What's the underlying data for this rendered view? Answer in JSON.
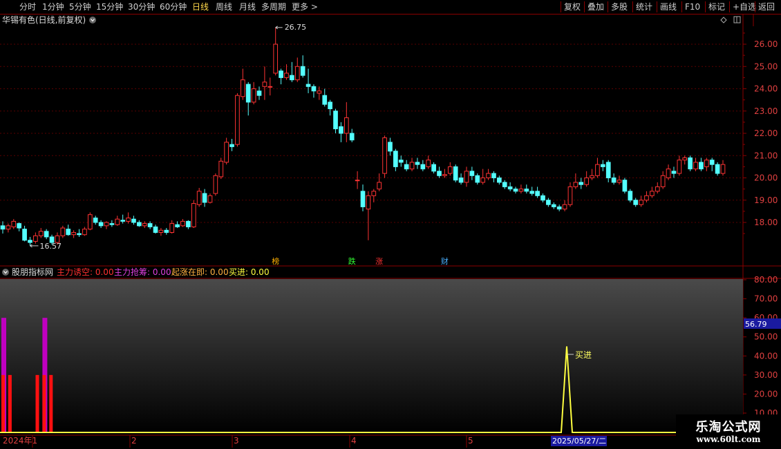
{
  "toolbar": {
    "left": [
      {
        "name": "tab-fenshi",
        "label": "分时"
      },
      {
        "name": "tab-1min",
        "label": "1分钟"
      },
      {
        "name": "tab-5min",
        "label": "5分钟"
      },
      {
        "name": "tab-15min",
        "label": "15分钟"
      },
      {
        "name": "tab-30min",
        "label": "30分钟"
      },
      {
        "name": "tab-60min",
        "label": "60分钟"
      },
      {
        "name": "tab-daily",
        "label": "日线",
        "active": true
      },
      {
        "name": "tab-weekly",
        "label": "周线"
      },
      {
        "name": "tab-monthly",
        "label": "月线"
      },
      {
        "name": "tab-multi-period",
        "label": "多周期"
      },
      {
        "name": "tab-more",
        "label": "更多 >"
      }
    ],
    "right": [
      {
        "name": "btn-fuquan",
        "label": "复权"
      },
      {
        "name": "btn-diejia",
        "label": "叠加"
      },
      {
        "name": "btn-duogu",
        "label": "多股"
      },
      {
        "name": "btn-tongji",
        "label": "统计"
      },
      {
        "name": "btn-huaxian",
        "label": "画线"
      },
      {
        "name": "btn-f10",
        "label": "F10"
      },
      {
        "name": "btn-biaoji",
        "label": "标记"
      },
      {
        "name": "btn-zixuan",
        "label": "+自选"
      },
      {
        "name": "btn-fanhui",
        "label": "返回"
      }
    ]
  },
  "main_panel": {
    "title": "华锡有色(日线,前复权)",
    "y_ticks": [
      "26.00",
      "25.00",
      "24.00",
      "23.00",
      "22.00",
      "21.00",
      "20.00",
      "19.00",
      "18.00"
    ],
    "high_label": "26.75",
    "low_label": "16.57",
    "markers": [
      {
        "label": "榜",
        "color": "#ffb000",
        "idx": 50
      },
      {
        "label": "跌",
        "color": "#33ff33",
        "idx": 64
      },
      {
        "label": "涨",
        "color": "#ff3333",
        "idx": 69
      },
      {
        "label": "财",
        "color": "#4ab0ff",
        "idx": 81
      }
    ]
  },
  "indicator_panel": {
    "title": "股朋指标网",
    "legend": [
      {
        "label": "主力诱空: 0.00",
        "color": "#ff3030"
      },
      {
        "label": "主力抢筹: 0.00",
        "color": "#e040e0"
      },
      {
        "label": "起涨在即: 0.00",
        "color": "#ffb040"
      },
      {
        "label": "买进: 0.00",
        "color": "#ffff40"
      }
    ],
    "y_ticks": [
      "80.00",
      "70.00",
      "60.00",
      "50.00",
      "40.00",
      "30.00",
      "20.00",
      "10.00"
    ],
    "current_value": "56.79",
    "buy_label": "买进"
  },
  "timeline": {
    "year_label": "2024年1",
    "months": [
      "2",
      "3",
      "4",
      "5"
    ],
    "cursor_date": "2025/05/27/二"
  },
  "watermark": {
    "title": "乐淘公式网",
    "url": "www.60lt.com"
  },
  "colors": {
    "up": "#ff3333",
    "down": "#54ffff",
    "axis": "#8b0000",
    "buy_line": "#ffff40"
  },
  "chart_data": {
    "type": "candlestick",
    "ylim": [
      17.0,
      27.0
    ],
    "candles": [
      [
        17.85,
        17.7,
        18.05,
        17.5
      ],
      [
        17.7,
        17.85,
        17.95,
        17.55
      ],
      [
        17.8,
        18.05,
        18.15,
        17.7
      ],
      [
        17.95,
        17.75,
        18.0,
        17.6
      ],
      [
        17.7,
        17.2,
        17.85,
        17.15
      ],
      [
        17.2,
        17.1,
        17.35,
        16.95
      ],
      [
        17.15,
        17.4,
        17.55,
        17.05
      ],
      [
        17.4,
        17.6,
        17.75,
        17.3
      ],
      [
        17.6,
        17.35,
        17.7,
        17.25
      ],
      [
        17.35,
        17.1,
        17.45,
        17.0
      ],
      [
        17.1,
        17.4,
        17.55,
        17.0
      ],
      [
        17.4,
        17.75,
        17.85,
        17.3
      ],
      [
        17.7,
        17.45,
        17.9,
        17.4
      ],
      [
        17.45,
        17.55,
        17.65,
        17.3
      ],
      [
        17.5,
        17.45,
        17.7,
        17.35
      ],
      [
        17.45,
        17.7,
        17.8,
        17.4
      ],
      [
        17.7,
        18.35,
        18.45,
        17.65
      ],
      [
        18.2,
        18.0,
        18.3,
        17.9
      ],
      [
        18.0,
        17.85,
        18.1,
        17.75
      ],
      [
        17.85,
        18.0,
        18.05,
        17.7
      ],
      [
        17.95,
        17.9,
        18.1,
        17.8
      ],
      [
        17.9,
        18.15,
        18.3,
        17.85
      ],
      [
        18.1,
        18.05,
        18.35,
        17.95
      ],
      [
        18.05,
        18.2,
        18.45,
        17.95
      ],
      [
        18.15,
        18.0,
        18.3,
        17.9
      ],
      [
        18.0,
        17.85,
        18.1,
        17.8
      ],
      [
        17.85,
        17.95,
        18.05,
        17.75
      ],
      [
        17.95,
        17.8,
        18.05,
        17.7
      ],
      [
        17.8,
        17.55,
        17.9,
        17.5
      ],
      [
        17.55,
        17.65,
        17.75,
        17.4
      ],
      [
        17.65,
        17.55,
        17.75,
        17.45
      ],
      [
        17.55,
        17.95,
        18.1,
        17.5
      ],
      [
        17.9,
        17.8,
        18.05,
        17.75
      ],
      [
        17.85,
        18.05,
        18.15,
        17.8
      ],
      [
        18.05,
        17.8,
        18.1,
        17.7
      ],
      [
        17.8,
        18.85,
        19.0,
        17.75
      ],
      [
        18.8,
        19.4,
        19.55,
        18.7
      ],
      [
        19.3,
        18.9,
        19.5,
        18.7
      ],
      [
        18.9,
        19.2,
        19.3,
        18.85
      ],
      [
        19.3,
        20.1,
        20.2,
        19.2
      ],
      [
        20.05,
        20.75,
        20.9,
        19.95
      ],
      [
        20.7,
        21.6,
        21.8,
        20.6
      ],
      [
        21.5,
        21.4,
        21.75,
        21.2
      ],
      [
        21.5,
        23.7,
        23.8,
        21.4
      ],
      [
        23.65,
        24.4,
        24.9,
        23.5
      ],
      [
        24.2,
        23.4,
        24.3,
        22.8
      ],
      [
        23.4,
        24.0,
        24.3,
        23.3
      ],
      [
        23.9,
        23.7,
        24.1,
        23.5
      ],
      [
        24.1,
        24.3,
        25.0,
        23.5
      ],
      [
        24.1,
        24.1,
        24.5,
        23.7
      ],
      [
        24.7,
        26.0,
        26.75,
        24.6
      ],
      [
        24.8,
        24.5,
        24.9,
        24.2
      ],
      [
        24.5,
        24.7,
        25.1,
        24.4
      ],
      [
        24.6,
        24.4,
        25.2,
        24.3
      ],
      [
        24.4,
        25.0,
        25.4,
        24.3
      ],
      [
        25.0,
        24.6,
        25.5,
        24.5
      ],
      [
        24.2,
        24.1,
        24.9,
        23.8
      ],
      [
        24.1,
        23.9,
        24.2,
        23.6
      ],
      [
        23.8,
        23.9,
        24.1,
        23.5
      ],
      [
        23.7,
        23.3,
        24.0,
        23.2
      ],
      [
        23.4,
        23.1,
        23.5,
        22.8
      ],
      [
        23.0,
        22.2,
        23.1,
        22.0
      ],
      [
        22.3,
        22.0,
        22.5,
        21.6
      ],
      [
        22.0,
        22.7,
        23.4,
        21.6
      ],
      [
        22.0,
        21.7,
        22.2,
        21.6
      ],
      [
        19.9,
        19.9,
        20.3,
        19.5
      ],
      [
        19.4,
        18.7,
        19.7,
        18.5
      ],
      [
        18.6,
        19.2,
        19.4,
        17.2
      ],
      [
        19.2,
        19.4,
        19.5,
        18.9
      ],
      [
        19.5,
        19.8,
        20.2,
        19.4
      ],
      [
        20.2,
        21.8,
        21.9,
        20.0
      ],
      [
        21.6,
        21.2,
        21.8,
        21.0
      ],
      [
        21.2,
        20.5,
        21.3,
        20.3
      ],
      [
        20.8,
        20.7,
        21.0,
        20.5
      ],
      [
        20.6,
        20.4,
        20.8,
        20.3
      ],
      [
        20.4,
        20.7,
        20.9,
        20.3
      ],
      [
        20.7,
        20.6,
        20.9,
        20.4
      ],
      [
        20.6,
        20.4,
        20.8,
        20.3
      ],
      [
        20.5,
        20.8,
        21.0,
        20.4
      ],
      [
        20.6,
        20.3,
        20.7,
        20.2
      ],
      [
        20.3,
        20.1,
        20.5,
        20.0
      ],
      [
        20.1,
        20.15,
        20.4,
        20.0
      ],
      [
        20.2,
        20.5,
        20.7,
        20.1
      ],
      [
        20.5,
        19.9,
        20.6,
        19.8
      ],
      [
        20.0,
        19.8,
        20.2,
        19.7
      ],
      [
        19.8,
        20.3,
        20.5,
        19.6
      ],
      [
        20.3,
        20.1,
        20.5,
        19.9
      ],
      [
        20.1,
        19.8,
        20.2,
        19.7
      ],
      [
        19.8,
        20.0,
        20.4,
        19.7
      ],
      [
        20.0,
        20.2,
        20.4,
        19.9
      ],
      [
        20.2,
        20.0,
        20.3,
        19.8
      ],
      [
        20.0,
        19.8,
        20.1,
        19.7
      ],
      [
        19.8,
        19.6,
        19.9,
        19.5
      ],
      [
        19.6,
        19.5,
        19.8,
        19.4
      ],
      [
        19.5,
        19.4,
        19.6,
        19.3
      ],
      [
        19.4,
        19.5,
        19.7,
        19.3
      ],
      [
        19.5,
        19.4,
        19.7,
        19.3
      ],
      [
        19.4,
        19.3,
        19.6,
        19.2
      ],
      [
        19.4,
        19.2,
        19.6,
        19.1
      ],
      [
        19.2,
        19.0,
        19.3,
        18.9
      ],
      [
        19.0,
        18.8,
        19.1,
        18.7
      ],
      [
        18.8,
        18.7,
        18.9,
        18.6
      ],
      [
        18.7,
        18.6,
        18.8,
        18.5
      ],
      [
        18.6,
        18.8,
        19.0,
        18.5
      ],
      [
        18.8,
        19.6,
        19.8,
        18.7
      ],
      [
        19.6,
        19.8,
        20.2,
        19.5
      ],
      [
        19.8,
        19.7,
        20.0,
        19.5
      ],
      [
        19.7,
        20.0,
        20.3,
        19.6
      ],
      [
        20.0,
        20.1,
        20.4,
        19.9
      ],
      [
        20.1,
        20.6,
        20.9,
        20.0
      ],
      [
        20.6,
        20.5,
        20.8,
        20.3
      ],
      [
        20.7,
        20.0,
        20.8,
        19.8
      ],
      [
        20.0,
        19.8,
        20.2,
        19.7
      ],
      [
        19.8,
        19.9,
        20.1,
        19.7
      ],
      [
        19.9,
        19.4,
        20.0,
        19.3
      ],
      [
        19.4,
        19.0,
        19.5,
        18.9
      ],
      [
        19.0,
        18.8,
        19.1,
        18.7
      ],
      [
        18.8,
        19.0,
        19.2,
        18.7
      ],
      [
        19.0,
        19.2,
        19.4,
        18.9
      ],
      [
        19.2,
        19.4,
        19.6,
        19.1
      ],
      [
        19.4,
        19.6,
        19.8,
        19.3
      ],
      [
        19.6,
        20.1,
        20.3,
        19.5
      ],
      [
        20.0,
        20.4,
        20.6,
        19.9
      ],
      [
        20.3,
        20.2,
        20.5,
        20.0
      ],
      [
        20.2,
        20.8,
        21.0,
        20.1
      ],
      [
        20.8,
        20.9,
        21.0,
        20.6
      ],
      [
        20.9,
        20.4,
        21.0,
        20.3
      ],
      [
        20.4,
        20.7,
        20.9,
        20.3
      ],
      [
        20.7,
        20.4,
        20.9,
        20.3
      ],
      [
        20.5,
        20.8,
        20.9,
        20.3
      ],
      [
        20.8,
        20.6,
        20.9,
        20.3
      ],
      [
        20.6,
        20.2,
        20.7,
        20.1
      ],
      [
        20.2,
        20.6,
        20.8,
        20.1
      ]
    ],
    "indicator": {
      "y_range": [
        0,
        85
      ],
      "count": 134,
      "red_bars": [
        [
          0,
          30
        ],
        [
          1,
          30
        ],
        [
          5,
          30
        ],
        [
          6,
          30
        ],
        [
          7,
          30
        ]
      ],
      "magenta_bars": [
        [
          0,
          60
        ],
        [
          6,
          60
        ]
      ],
      "buy_line_points": [
        [
          0,
          0
        ],
        [
          99,
          0
        ],
        [
          100,
          45
        ],
        [
          101,
          0
        ],
        [
          133,
          0
        ]
      ]
    }
  }
}
